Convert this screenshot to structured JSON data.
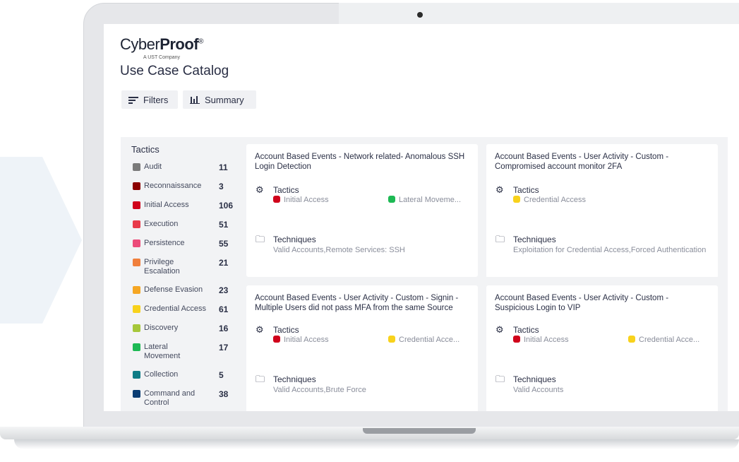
{
  "brand": {
    "name_light": "Cyber",
    "name_bold": "Proof",
    "mark": "®",
    "sub": "A UST Company"
  },
  "page": {
    "title": "Use Case Catalog"
  },
  "toolbar": {
    "filters_label": "Filters",
    "summary_label": "Summary"
  },
  "tactics": {
    "title": "Tactics",
    "items": [
      {
        "label": "Audit",
        "count": "11",
        "color": "#7a7a7a"
      },
      {
        "label": "Reconnaissance",
        "count": "3",
        "color": "#8b0000"
      },
      {
        "label": "Initial Access",
        "count": "106",
        "color": "#d0021b"
      },
      {
        "label": "Execution",
        "count": "51",
        "color": "#e83a4a"
      },
      {
        "label": "Persistence",
        "count": "55",
        "color": "#ec4c7a"
      },
      {
        "label": "Privilege Escalation",
        "count": "21",
        "color": "#f07f3c"
      },
      {
        "label": "Defense Evasion",
        "count": "23",
        "color": "#f5a623"
      },
      {
        "label": "Credential Access",
        "count": "61",
        "color": "#f8d21c"
      },
      {
        "label": "Discovery",
        "count": "16",
        "color": "#a6c73a"
      },
      {
        "label": "Lateral Movement",
        "count": "17",
        "color": "#1db954"
      },
      {
        "label": "Collection",
        "count": "5",
        "color": "#0e7c86"
      },
      {
        "label": "Command and Control",
        "count": "38",
        "color": "#0b3d73"
      }
    ]
  },
  "cards": [
    {
      "title": "Account Based Events - Network related- Anomalous SSH Login Detection",
      "tactics_label": "Tactics",
      "tags": [
        {
          "label": "Initial Access",
          "color": "#d0021b"
        },
        {
          "label": "Lateral Moveme...",
          "color": "#1db954"
        }
      ],
      "techniques_label": "Techniques",
      "techniques": "Valid Accounts,Remote Services: SSH"
    },
    {
      "title": "Account Based Events - User Activity - Custom - Compromised account monitor 2FA",
      "tactics_label": "Tactics",
      "tags": [
        {
          "label": "Credential Access",
          "color": "#f8d21c"
        }
      ],
      "techniques_label": "Techniques",
      "techniques": "Exploitation for Credential Access,Forced Authentication"
    },
    {
      "title": "Account Based Events - User Activity - Custom - Signin - Multiple Users did not pass MFA from the same Source",
      "tactics_label": "Tactics",
      "tags": [
        {
          "label": "Initial Access",
          "color": "#d0021b"
        },
        {
          "label": "Credential Acce...",
          "color": "#f8d21c"
        }
      ],
      "techniques_label": "Techniques",
      "techniques": "Valid Accounts,Brute Force"
    },
    {
      "title": "Account Based Events - User Activity - Custom - Suspicious Login to VIP",
      "tactics_label": "Tactics",
      "tags": [
        {
          "label": "Initial Access",
          "color": "#d0021b"
        },
        {
          "label": "Credential Acce...",
          "color": "#f8d21c"
        }
      ],
      "techniques_label": "Techniques",
      "techniques": "Valid Accounts"
    }
  ]
}
